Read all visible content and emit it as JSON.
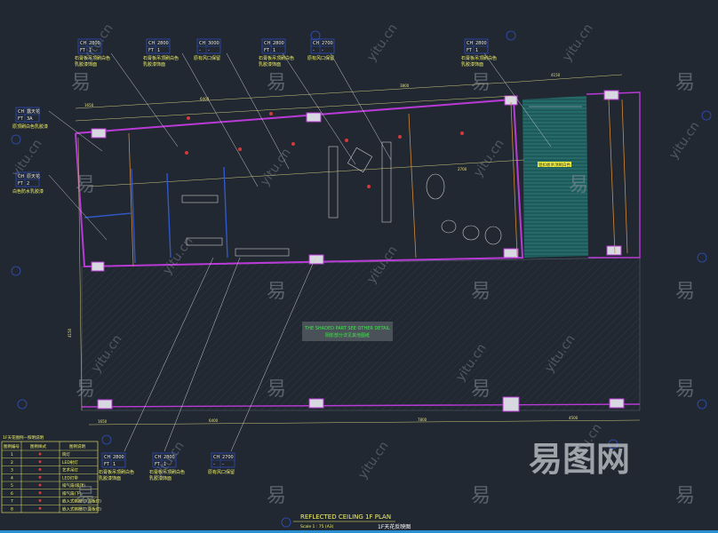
{
  "drawing": {
    "title": "REFLECTED CEILING 1F PLAN",
    "scale": "Scale 1 : 75 (A3)",
    "title_cn": "1F天花反映图",
    "shaded_note_en": "THE SHADED PART SEE OTHER DETAIL",
    "shaded_note_cn": "阴影部分详见其他图纸"
  },
  "legend": {
    "title": "1F天花图例—照明说明",
    "headers": [
      "图例编号",
      "图例样式",
      "图例说明"
    ],
    "rows": [
      {
        "no": "1",
        "desc": "筒灯"
      },
      {
        "no": "2",
        "desc": "LED射灯"
      },
      {
        "no": "3",
        "desc": "艺术吊灯"
      },
      {
        "no": "4",
        "desc": "LED灯带"
      },
      {
        "no": "5",
        "desc": "排气扇(吸顶)"
      },
      {
        "no": "6",
        "desc": "排气扇(下)"
      },
      {
        "no": "7",
        "desc": "嵌入式格栅灯(面板灯)"
      },
      {
        "no": "8",
        "desc": "嵌入式格栅灯(面板灯)"
      }
    ]
  },
  "callouts": [
    {
      "k1": "CH",
      "v1": "2800",
      "k2": "FT",
      "v2": "1",
      "note1": "石膏板吊顶刷白色",
      "note2": "乳胶漆饰面"
    },
    {
      "k1": "CH",
      "v1": "2800",
      "k2": "FT",
      "v2": "1",
      "note1": "石膏板吊顶刷白色",
      "note2": "乳胶漆饰面"
    },
    {
      "k1": "CH",
      "v1": "3000",
      "k2": "-",
      "v2": "-",
      "note1": "原有风口保留",
      "note2": ""
    },
    {
      "k1": "CH",
      "v1": "2800",
      "k2": "FT",
      "v2": "1",
      "note1": "石膏板吊顶刷白色",
      "note2": "乳胶漆饰面"
    },
    {
      "k1": "CH",
      "v1": "2700",
      "k2": "-",
      "v2": "-",
      "note1": "原有风口保留",
      "note2": ""
    },
    {
      "k1": "CH",
      "v1": "2800",
      "k2": "FT",
      "v2": "1",
      "note1": "石膏板吊顶刷白色",
      "note2": "乳胶漆饰面"
    },
    {
      "k1": "CH",
      "v1": "露天花",
      "k2": "FT",
      "v2": "3A",
      "note1": "原顶刷白色乳胶漆",
      "note2": ""
    },
    {
      "k1": "CH",
      "v1": "原天花",
      "k2": "FT",
      "v2": "2",
      "note1": "白色防水乳胶漆",
      "note2": ""
    },
    {
      "k1": "CH",
      "v1": "2800",
      "k2": "FT",
      "v2": "1",
      "note1": "石膏板吊顶刷白色",
      "note2": "乳胶漆饰面"
    },
    {
      "k1": "CH",
      "v1": "2800",
      "k2": "FT",
      "v2": "1",
      "note1": "石膏板吊顶刷白色",
      "note2": "乳胶漆饰面"
    },
    {
      "k1": "CH",
      "v1": "2700",
      "k2": "-",
      "v2": "-",
      "note1": "原有风口保留",
      "note2": ""
    }
  ],
  "dimensions": [
    "1650",
    "6400",
    "3800",
    "4150",
    "2700",
    "1650",
    "6400",
    "7800",
    "4500",
    "4150"
  ],
  "room_label": "铝扣板吊顶刷白色",
  "watermarks": {
    "char": "易",
    "url": "yitu.cn",
    "logo": "易图网"
  }
}
